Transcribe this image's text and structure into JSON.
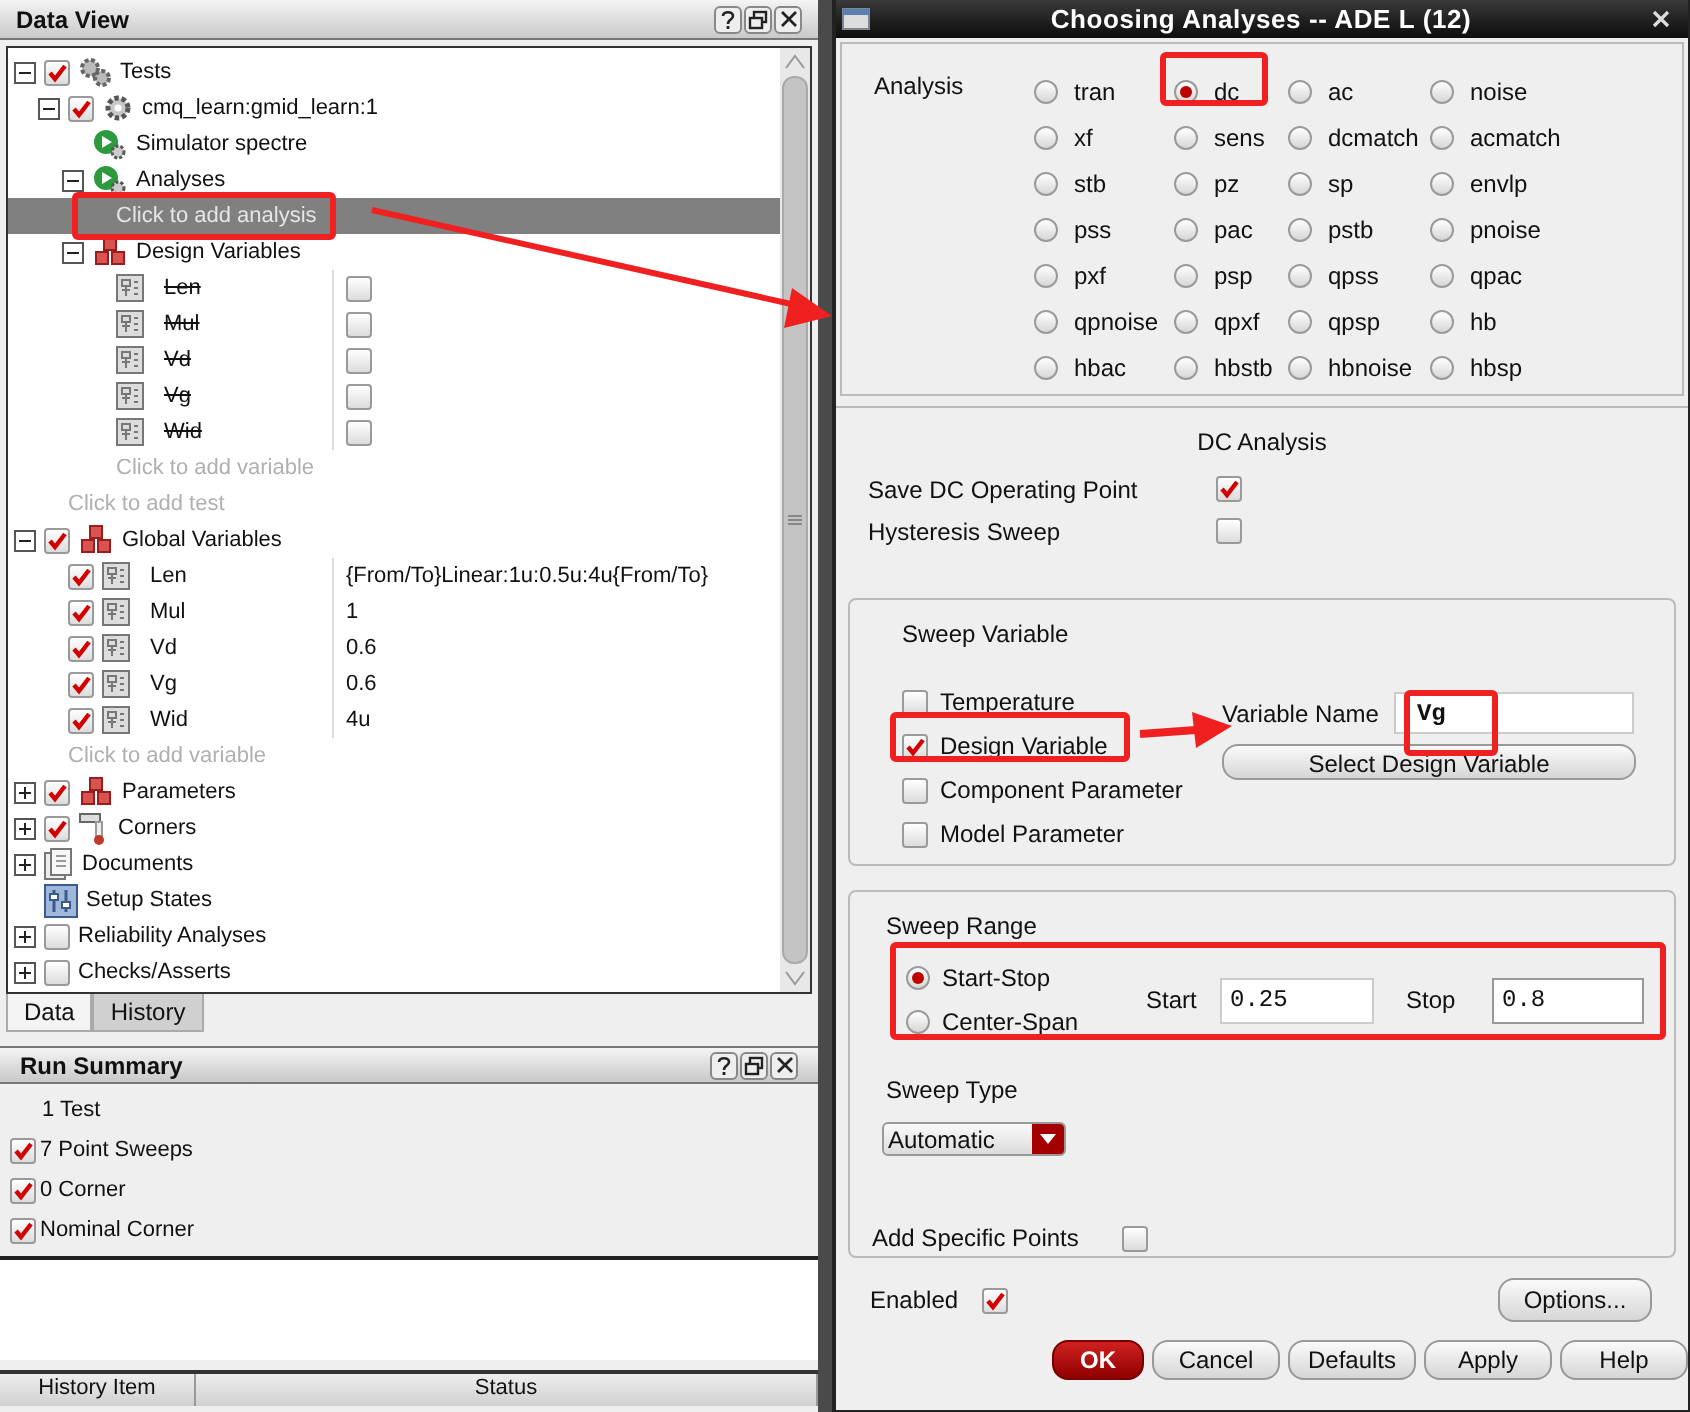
{
  "data_view": {
    "title": "Data View",
    "tree": [
      {
        "label": "Tests",
        "kind": "tests",
        "checked": true,
        "expanded": true,
        "selected": false,
        "children": [
          {
            "label": "cmq_learn:gmid_learn:1",
            "kind": "test",
            "checked": true,
            "expanded": true,
            "selected": false,
            "children": [
              {
                "label": "Simulator  spectre",
                "kind": "simulator",
                "selected": false
              },
              {
                "label": "Analyses",
                "kind": "analyses",
                "expanded": true,
                "selected": false,
                "children": [
                  {
                    "label": "Click to add analysis",
                    "kind": "placeholder",
                    "selected": true
                  }
                ]
              },
              {
                "label": "Design Variables",
                "kind": "variables",
                "expanded": true,
                "selected": false,
                "children": [
                  {
                    "label": "Len",
                    "kind": "design_variable",
                    "struck": true,
                    "column_checked": false,
                    "selected": false
                  },
                  {
                    "label": "Mul",
                    "kind": "design_variable",
                    "struck": true,
                    "column_checked": false,
                    "selected": false
                  },
                  {
                    "label": "Vd",
                    "kind": "design_variable",
                    "struck": true,
                    "column_checked": false,
                    "selected": false
                  },
                  {
                    "label": "Vg",
                    "kind": "design_variable",
                    "struck": true,
                    "column_checked": false,
                    "selected": false
                  },
                  {
                    "label": "Wid",
                    "kind": "design_variable",
                    "struck": true,
                    "column_checked": false,
                    "selected": false
                  },
                  {
                    "label": "Click to add variable",
                    "kind": "placeholder",
                    "selected": false
                  }
                ]
              }
            ]
          },
          {
            "label": "Click to add test",
            "kind": "placeholder",
            "selected": false
          }
        ]
      },
      {
        "label": "Global Variables",
        "kind": "variables",
        "checked": true,
        "expanded": true,
        "selected": false,
        "children": [
          {
            "label": "Len",
            "kind": "global_variable",
            "checked": true,
            "value": "{From/To}Linear:1u:0.5u:4u{From/To}",
            "selected": false
          },
          {
            "label": "Mul",
            "kind": "global_variable",
            "checked": true,
            "value": "1",
            "selected": false
          },
          {
            "label": "Vd",
            "kind": "global_variable",
            "checked": true,
            "value": "0.6",
            "selected": false
          },
          {
            "label": "Vg",
            "kind": "global_variable",
            "checked": true,
            "value": "0.6",
            "selected": false
          },
          {
            "label": "Wid",
            "kind": "global_variable",
            "checked": true,
            "value": "4u",
            "selected": false
          },
          {
            "label": "Click to add variable",
            "kind": "placeholder",
            "selected": false
          }
        ]
      },
      {
        "label": "Parameters",
        "kind": "variables",
        "checked": true,
        "expanded": false,
        "selected": false
      },
      {
        "label": "Corners",
        "kind": "corners",
        "checked": true,
        "expanded": false,
        "selected": false
      },
      {
        "label": "Documents",
        "kind": "documents",
        "expanded": false,
        "selected": false
      },
      {
        "label": "Setup States",
        "kind": "setup_states",
        "selected": false
      },
      {
        "label": "Reliability Analyses",
        "kind": "plain",
        "checked": false,
        "expanded": false,
        "selected": false
      },
      {
        "label": "Checks/Asserts",
        "kind": "plain",
        "checked": false,
        "expanded": false,
        "selected": false
      }
    ]
  },
  "tabs": [
    {
      "label": "Data",
      "selected": true
    },
    {
      "label": "History",
      "selected": false
    }
  ],
  "run_summary": {
    "title": "Run Summary",
    "items": [
      {
        "label": "1 Test",
        "kind": "count"
      },
      {
        "label": "7 Point Sweeps",
        "kind": "checkbox",
        "checked": true
      },
      {
        "label": "0 Corner",
        "kind": "checkbox",
        "checked": true
      },
      {
        "label": "Nominal Corner",
        "kind": "checkbox",
        "checked": true
      }
    ]
  },
  "history_table": {
    "columns": [
      "History Item",
      "Status"
    ]
  },
  "dialog": {
    "title": "Choosing Analyses -- ADE L (12)",
    "analysis_label": "Analysis",
    "analyses": [
      {
        "label": "tran",
        "selected": false
      },
      {
        "label": "dc",
        "selected": true
      },
      {
        "label": "ac",
        "selected": false
      },
      {
        "label": "noise",
        "selected": false
      },
      {
        "label": "xf",
        "selected": false
      },
      {
        "label": "sens",
        "selected": false
      },
      {
        "label": "dcmatch",
        "selected": false
      },
      {
        "label": "acmatch",
        "selected": false
      },
      {
        "label": "stb",
        "selected": false
      },
      {
        "label": "pz",
        "selected": false
      },
      {
        "label": "sp",
        "selected": false
      },
      {
        "label": "envlp",
        "selected": false
      },
      {
        "label": "pss",
        "selected": false
      },
      {
        "label": "pac",
        "selected": false
      },
      {
        "label": "pstb",
        "selected": false
      },
      {
        "label": "pnoise",
        "selected": false
      },
      {
        "label": "pxf",
        "selected": false
      },
      {
        "label": "psp",
        "selected": false
      },
      {
        "label": "qpss",
        "selected": false
      },
      {
        "label": "qpac",
        "selected": false
      },
      {
        "label": "qpnoise",
        "selected": false
      },
      {
        "label": "qpxf",
        "selected": false
      },
      {
        "label": "qpsp",
        "selected": false
      },
      {
        "label": "hb",
        "selected": false
      },
      {
        "label": "hbac",
        "selected": false
      },
      {
        "label": "hbstb",
        "selected": false
      },
      {
        "label": "hbnoise",
        "selected": false
      },
      {
        "label": "hbsp",
        "selected": false
      }
    ],
    "section_title": "DC Analysis",
    "options": [
      {
        "label": "Save DC Operating Point",
        "checked": true
      },
      {
        "label": "Hysteresis Sweep",
        "checked": false
      }
    ],
    "sweep_variable": {
      "title": "Sweep Variable",
      "choices": [
        {
          "label": "Temperature",
          "checked": false
        },
        {
          "label": "Design Variable",
          "checked": true
        },
        {
          "label": "Component Parameter",
          "checked": false
        },
        {
          "label": "Model Parameter",
          "checked": false
        }
      ],
      "variable_name_label": "Variable Name",
      "variable_name": "Vg",
      "select_button": "Select Design Variable"
    },
    "sweep_range": {
      "title": "Sweep Range",
      "modes": [
        {
          "label": "Start-Stop",
          "selected": true
        },
        {
          "label": "Center-Span",
          "selected": false
        }
      ],
      "start_label": "Start",
      "start": "0.25",
      "stop_label": "Stop",
      "stop": "0.8"
    },
    "sweep_type": {
      "title": "Sweep Type",
      "value": "Automatic"
    },
    "add_specific_points": {
      "label": "Add Specific Points",
      "checked": false
    },
    "enabled": {
      "label": "Enabled",
      "checked": true
    },
    "options_button": "Options...",
    "buttons": [
      {
        "label": "OK",
        "kind": "primary"
      },
      {
        "label": "Cancel",
        "kind": "normal"
      },
      {
        "label": "Defaults",
        "kind": "normal"
      },
      {
        "label": "Apply",
        "kind": "normal"
      },
      {
        "label": "Help",
        "kind": "normal"
      }
    ]
  }
}
